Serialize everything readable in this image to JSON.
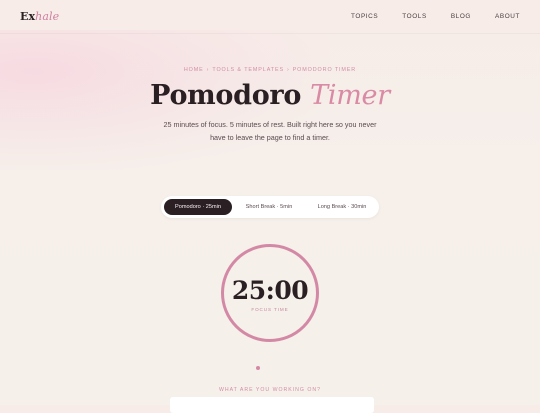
{
  "header": {
    "logo_main": "Ex",
    "logo_accent": "hale",
    "nav": [
      "TOPICS",
      "TOOLS",
      "BLOG",
      "ABOUT"
    ]
  },
  "breadcrumb": {
    "items": [
      "HOME",
      "TOOLS & TEMPLATES",
      "POMODORO TIMER"
    ],
    "separator": "›"
  },
  "hero": {
    "title_main": "Pomodoro",
    "title_accent": "Timer",
    "subtitle_line1": "25 minutes of focus. 5 minutes of rest. Built right here so you never",
    "subtitle_line2": "have to leave the page to find a timer."
  },
  "modes": {
    "items": [
      "Pomodoro · 25min",
      "Short Break · 5min",
      "Long Break · 30min"
    ],
    "active_index": 0
  },
  "timer": {
    "display": "25:00",
    "label": "FOCUS TIME"
  },
  "task": {
    "prompt": "WHAT ARE YOU WORKING ON?",
    "value": ""
  },
  "colors": {
    "accent": "#d389a5",
    "dark": "#2a1f22",
    "background": "#f6efea"
  }
}
